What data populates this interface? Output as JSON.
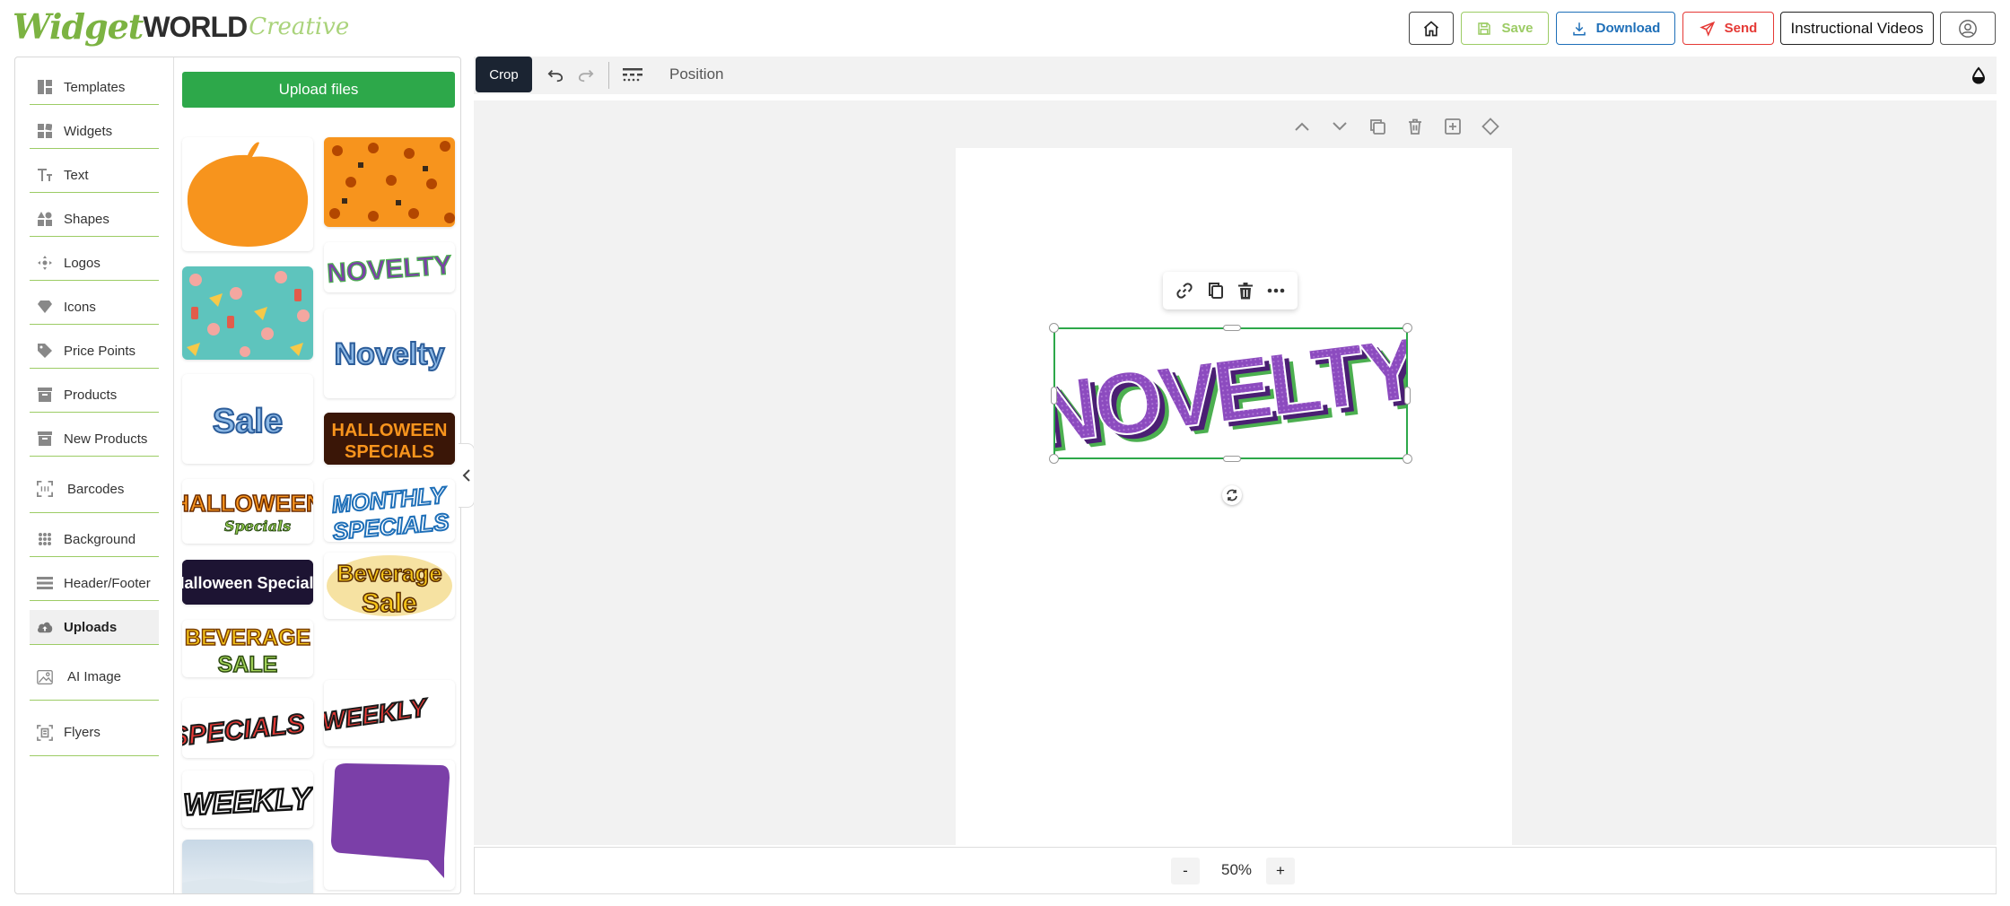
{
  "brand": {
    "part1": "Widget",
    "part2": "WORLD",
    "part3": "Creative"
  },
  "header": {
    "save_label": "Save",
    "download_label": "Download",
    "send_label": "Send",
    "videos_label": "Instructional Videos"
  },
  "sidebar": {
    "items": [
      {
        "label": "Templates",
        "icon": "templates-icon"
      },
      {
        "label": "Widgets",
        "icon": "widgets-icon"
      },
      {
        "label": "Text",
        "icon": "text-icon"
      },
      {
        "label": "Shapes",
        "icon": "shapes-icon"
      },
      {
        "label": "Logos",
        "icon": "logos-icon"
      },
      {
        "label": "Icons",
        "icon": "diamond-icon"
      },
      {
        "label": "Price Points",
        "icon": "tag-icon"
      },
      {
        "label": "Products",
        "icon": "archive-icon"
      },
      {
        "label": "New Products",
        "icon": "archive-icon"
      },
      {
        "label": "Barcodes",
        "icon": "barcode-icon"
      },
      {
        "label": "Background",
        "icon": "grid-icon"
      },
      {
        "label": "Header/Footer",
        "icon": "header-footer-icon"
      },
      {
        "label": "Uploads",
        "icon": "cloud-upload-icon"
      },
      {
        "label": "AI Image",
        "icon": "image-icon"
      },
      {
        "label": "Flyers",
        "icon": "flyer-icon"
      }
    ],
    "active": "Uploads"
  },
  "uploads": {
    "button_label": "Upload files",
    "tiles": [
      {
        "id": "pumpkin",
        "type": "pumpkin-shape"
      },
      {
        "id": "halloween-pattern",
        "type": "pattern"
      },
      {
        "id": "novelty-purple",
        "text": "NOVELTY"
      },
      {
        "id": "food-pattern",
        "type": "pattern"
      },
      {
        "id": "novelty-blue",
        "text": "Novelty"
      },
      {
        "id": "sale",
        "text": "Sale"
      },
      {
        "id": "halloween-specials-dark",
        "text": "HALLOWEEN SPECIALS"
      },
      {
        "id": "halloween-specials-orange",
        "text": "HALLOWEEN Specials"
      },
      {
        "id": "monthly-specials",
        "text": "MONTHLY SPECIALS"
      },
      {
        "id": "halloween-specials-purple",
        "text": "Halloween Specials"
      },
      {
        "id": "beverage-sale-badge",
        "text": "Beverage Sale"
      },
      {
        "id": "beverage-sale-yellow",
        "text": "BEVERAGE SALE"
      },
      {
        "id": "weekly-red",
        "text": "WEEKLY"
      },
      {
        "id": "specials-red",
        "text": "SPECIALS"
      },
      {
        "id": "speech-bubble",
        "type": "shape"
      },
      {
        "id": "weekly-white",
        "text": "WEEKLY"
      },
      {
        "id": "sky-photo",
        "type": "image"
      },
      {
        "id": "red-wave",
        "type": "shape"
      }
    ]
  },
  "toolbar": {
    "crop_label": "Crop",
    "position_label": "Position"
  },
  "canvas": {
    "selected_text": "NOVELTY"
  },
  "zoom": {
    "minus": "-",
    "value": "50%",
    "plus": "+"
  },
  "colors": {
    "brand_green": "#7cb342",
    "upload_green": "#2da84a",
    "download_blue": "#1e6fb8",
    "send_red": "#e53935",
    "crop_dark": "#1b2432",
    "novelty_purple": "#7b3fa8"
  }
}
